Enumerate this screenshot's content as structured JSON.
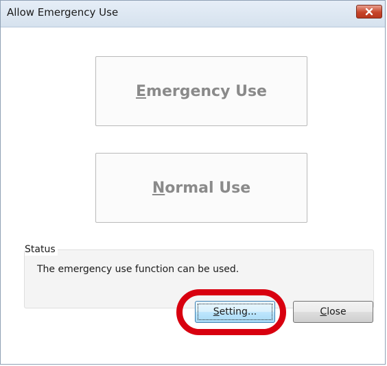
{
  "window": {
    "title": "Allow Emergency Use"
  },
  "buttons": {
    "emergency": {
      "accel": "E",
      "rest": "mergency Use"
    },
    "normal": {
      "accel": "N",
      "rest": "ormal Use"
    },
    "setting": {
      "accel": "S",
      "rest": "etting..."
    },
    "close": {
      "accel": "C",
      "rest": "lose"
    }
  },
  "status": {
    "legend": "Status",
    "message": "The emergency use function can be used."
  },
  "colors": {
    "highlight": "#d8000f",
    "close_button": "#c6452a",
    "big_button_text": "#8a8a8a"
  },
  "icons": {
    "close": "close-icon"
  }
}
